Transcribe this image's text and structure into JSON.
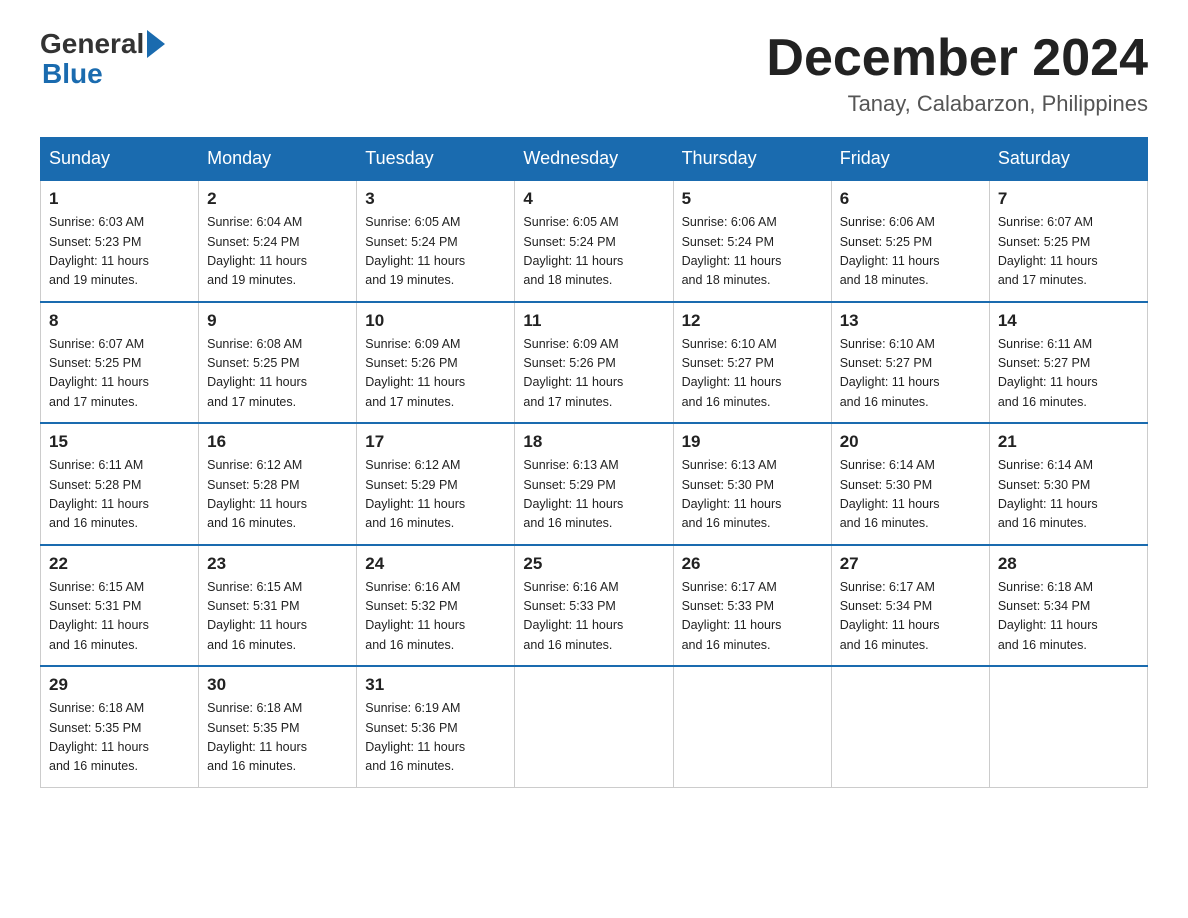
{
  "header": {
    "logo_general": "General",
    "logo_blue": "Blue",
    "month_title": "December 2024",
    "location": "Tanay, Calabarzon, Philippines"
  },
  "days_of_week": [
    "Sunday",
    "Monday",
    "Tuesday",
    "Wednesday",
    "Thursday",
    "Friday",
    "Saturday"
  ],
  "weeks": [
    [
      {
        "day": "1",
        "sunrise": "6:03 AM",
        "sunset": "5:23 PM",
        "daylight": "11 hours and 19 minutes."
      },
      {
        "day": "2",
        "sunrise": "6:04 AM",
        "sunset": "5:24 PM",
        "daylight": "11 hours and 19 minutes."
      },
      {
        "day": "3",
        "sunrise": "6:05 AM",
        "sunset": "5:24 PM",
        "daylight": "11 hours and 19 minutes."
      },
      {
        "day": "4",
        "sunrise": "6:05 AM",
        "sunset": "5:24 PM",
        "daylight": "11 hours and 18 minutes."
      },
      {
        "day": "5",
        "sunrise": "6:06 AM",
        "sunset": "5:24 PM",
        "daylight": "11 hours and 18 minutes."
      },
      {
        "day": "6",
        "sunrise": "6:06 AM",
        "sunset": "5:25 PM",
        "daylight": "11 hours and 18 minutes."
      },
      {
        "day": "7",
        "sunrise": "6:07 AM",
        "sunset": "5:25 PM",
        "daylight": "11 hours and 17 minutes."
      }
    ],
    [
      {
        "day": "8",
        "sunrise": "6:07 AM",
        "sunset": "5:25 PM",
        "daylight": "11 hours and 17 minutes."
      },
      {
        "day": "9",
        "sunrise": "6:08 AM",
        "sunset": "5:25 PM",
        "daylight": "11 hours and 17 minutes."
      },
      {
        "day": "10",
        "sunrise": "6:09 AM",
        "sunset": "5:26 PM",
        "daylight": "11 hours and 17 minutes."
      },
      {
        "day": "11",
        "sunrise": "6:09 AM",
        "sunset": "5:26 PM",
        "daylight": "11 hours and 17 minutes."
      },
      {
        "day": "12",
        "sunrise": "6:10 AM",
        "sunset": "5:27 PM",
        "daylight": "11 hours and 16 minutes."
      },
      {
        "day": "13",
        "sunrise": "6:10 AM",
        "sunset": "5:27 PM",
        "daylight": "11 hours and 16 minutes."
      },
      {
        "day": "14",
        "sunrise": "6:11 AM",
        "sunset": "5:27 PM",
        "daylight": "11 hours and 16 minutes."
      }
    ],
    [
      {
        "day": "15",
        "sunrise": "6:11 AM",
        "sunset": "5:28 PM",
        "daylight": "11 hours and 16 minutes."
      },
      {
        "day": "16",
        "sunrise": "6:12 AM",
        "sunset": "5:28 PM",
        "daylight": "11 hours and 16 minutes."
      },
      {
        "day": "17",
        "sunrise": "6:12 AM",
        "sunset": "5:29 PM",
        "daylight": "11 hours and 16 minutes."
      },
      {
        "day": "18",
        "sunrise": "6:13 AM",
        "sunset": "5:29 PM",
        "daylight": "11 hours and 16 minutes."
      },
      {
        "day": "19",
        "sunrise": "6:13 AM",
        "sunset": "5:30 PM",
        "daylight": "11 hours and 16 minutes."
      },
      {
        "day": "20",
        "sunrise": "6:14 AM",
        "sunset": "5:30 PM",
        "daylight": "11 hours and 16 minutes."
      },
      {
        "day": "21",
        "sunrise": "6:14 AM",
        "sunset": "5:30 PM",
        "daylight": "11 hours and 16 minutes."
      }
    ],
    [
      {
        "day": "22",
        "sunrise": "6:15 AM",
        "sunset": "5:31 PM",
        "daylight": "11 hours and 16 minutes."
      },
      {
        "day": "23",
        "sunrise": "6:15 AM",
        "sunset": "5:31 PM",
        "daylight": "11 hours and 16 minutes."
      },
      {
        "day": "24",
        "sunrise": "6:16 AM",
        "sunset": "5:32 PM",
        "daylight": "11 hours and 16 minutes."
      },
      {
        "day": "25",
        "sunrise": "6:16 AM",
        "sunset": "5:33 PM",
        "daylight": "11 hours and 16 minutes."
      },
      {
        "day": "26",
        "sunrise": "6:17 AM",
        "sunset": "5:33 PM",
        "daylight": "11 hours and 16 minutes."
      },
      {
        "day": "27",
        "sunrise": "6:17 AM",
        "sunset": "5:34 PM",
        "daylight": "11 hours and 16 minutes."
      },
      {
        "day": "28",
        "sunrise": "6:18 AM",
        "sunset": "5:34 PM",
        "daylight": "11 hours and 16 minutes."
      }
    ],
    [
      {
        "day": "29",
        "sunrise": "6:18 AM",
        "sunset": "5:35 PM",
        "daylight": "11 hours and 16 minutes."
      },
      {
        "day": "30",
        "sunrise": "6:18 AM",
        "sunset": "5:35 PM",
        "daylight": "11 hours and 16 minutes."
      },
      {
        "day": "31",
        "sunrise": "6:19 AM",
        "sunset": "5:36 PM",
        "daylight": "11 hours and 16 minutes."
      },
      null,
      null,
      null,
      null
    ]
  ],
  "labels": {
    "sunrise": "Sunrise:",
    "sunset": "Sunset:",
    "daylight": "Daylight:"
  }
}
